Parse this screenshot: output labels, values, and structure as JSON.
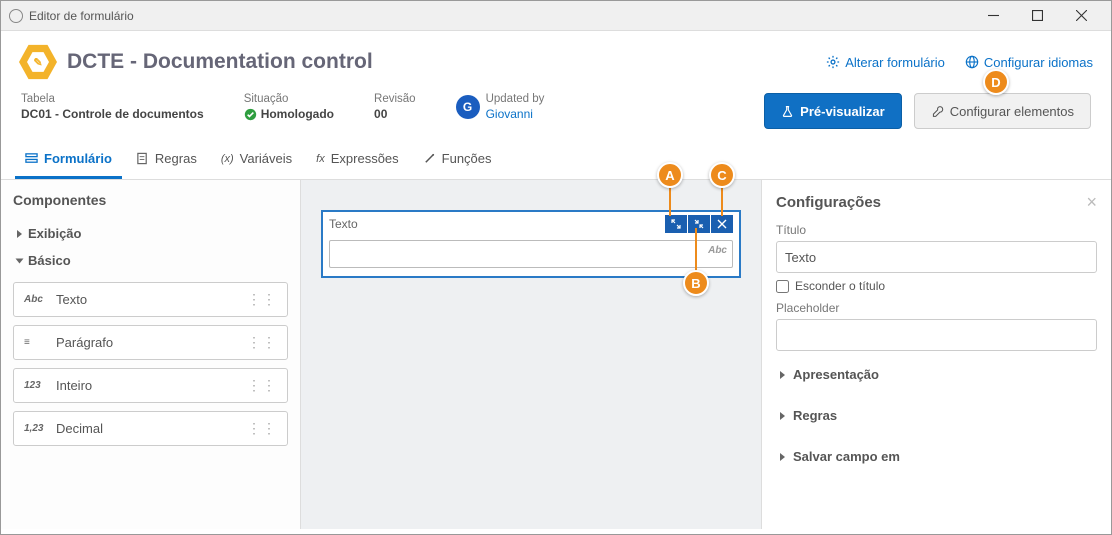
{
  "window": {
    "title": "Editor de formulário"
  },
  "header": {
    "title": "DCTE - Documentation control",
    "link_change": "Alterar formulário",
    "link_langs": "Configurar idiomas"
  },
  "meta": {
    "table_label": "Tabela",
    "table_value": "DC01 - Controle de documentos",
    "status_label": "Situação",
    "status_value": "Homologado",
    "rev_label": "Revisão",
    "rev_value": "00",
    "updated_label": "Updated by",
    "updated_user": "Giovanni",
    "updated_avatar": "G",
    "btn_preview": "Pré-visualizar",
    "btn_config": "Configurar elementos"
  },
  "tabs": {
    "form": "Formulário",
    "rules": "Regras",
    "vars": "Variáveis",
    "expr": "Expressões",
    "func": "Funções"
  },
  "sidebar": {
    "heading": "Componentes",
    "group_display": "Exibição",
    "group_basic": "Básico",
    "items": [
      {
        "ico": "Abc",
        "label": "Texto"
      },
      {
        "ico": "≡",
        "label": "Parágrafo"
      },
      {
        "ico": "123",
        "label": "Inteiro"
      },
      {
        "ico": "1,23",
        "label": "Decimal"
      }
    ]
  },
  "canvas": {
    "block_label": "Texto",
    "input_placeholder": ""
  },
  "panel": {
    "heading": "Configurações",
    "title_label": "Título",
    "title_value": "Texto",
    "hide_title": "Esconder o título",
    "placeholder_label": "Placeholder",
    "acc_presentation": "Apresentação",
    "acc_rules": "Regras",
    "acc_save": "Salvar campo em"
  },
  "annotations": {
    "a": "A",
    "b": "B",
    "c": "C",
    "d": "D"
  }
}
